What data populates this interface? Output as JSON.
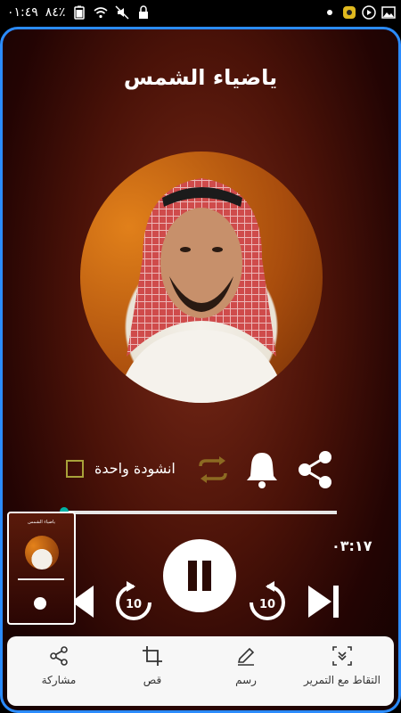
{
  "status_bar": {
    "time": "٠١:٤٩",
    "battery": "٨٤٪"
  },
  "player": {
    "title": "ياضياء الشمس",
    "repeat_label": "انشودة واحدة",
    "elapsed_time": "٠٣:١٧",
    "progress": 0.0,
    "skip_back_label": "10",
    "skip_forward_label": "10"
  },
  "screenshot_preview": {
    "title": "ياضياء الشمس"
  },
  "toolbar": {
    "items": [
      {
        "label": "مشاركة",
        "icon": "share-icon"
      },
      {
        "label": "قص",
        "icon": "crop-icon"
      },
      {
        "label": "رسم",
        "icon": "pen-icon"
      },
      {
        "label": "التقاط مع التمرير",
        "icon": "scroll-capture-icon"
      }
    ]
  },
  "colors": {
    "accent": "#00b3a6",
    "frame_border": "#2b8cff",
    "checkbox": "#a8a23a",
    "repeat_icon": "#8c6a22"
  }
}
